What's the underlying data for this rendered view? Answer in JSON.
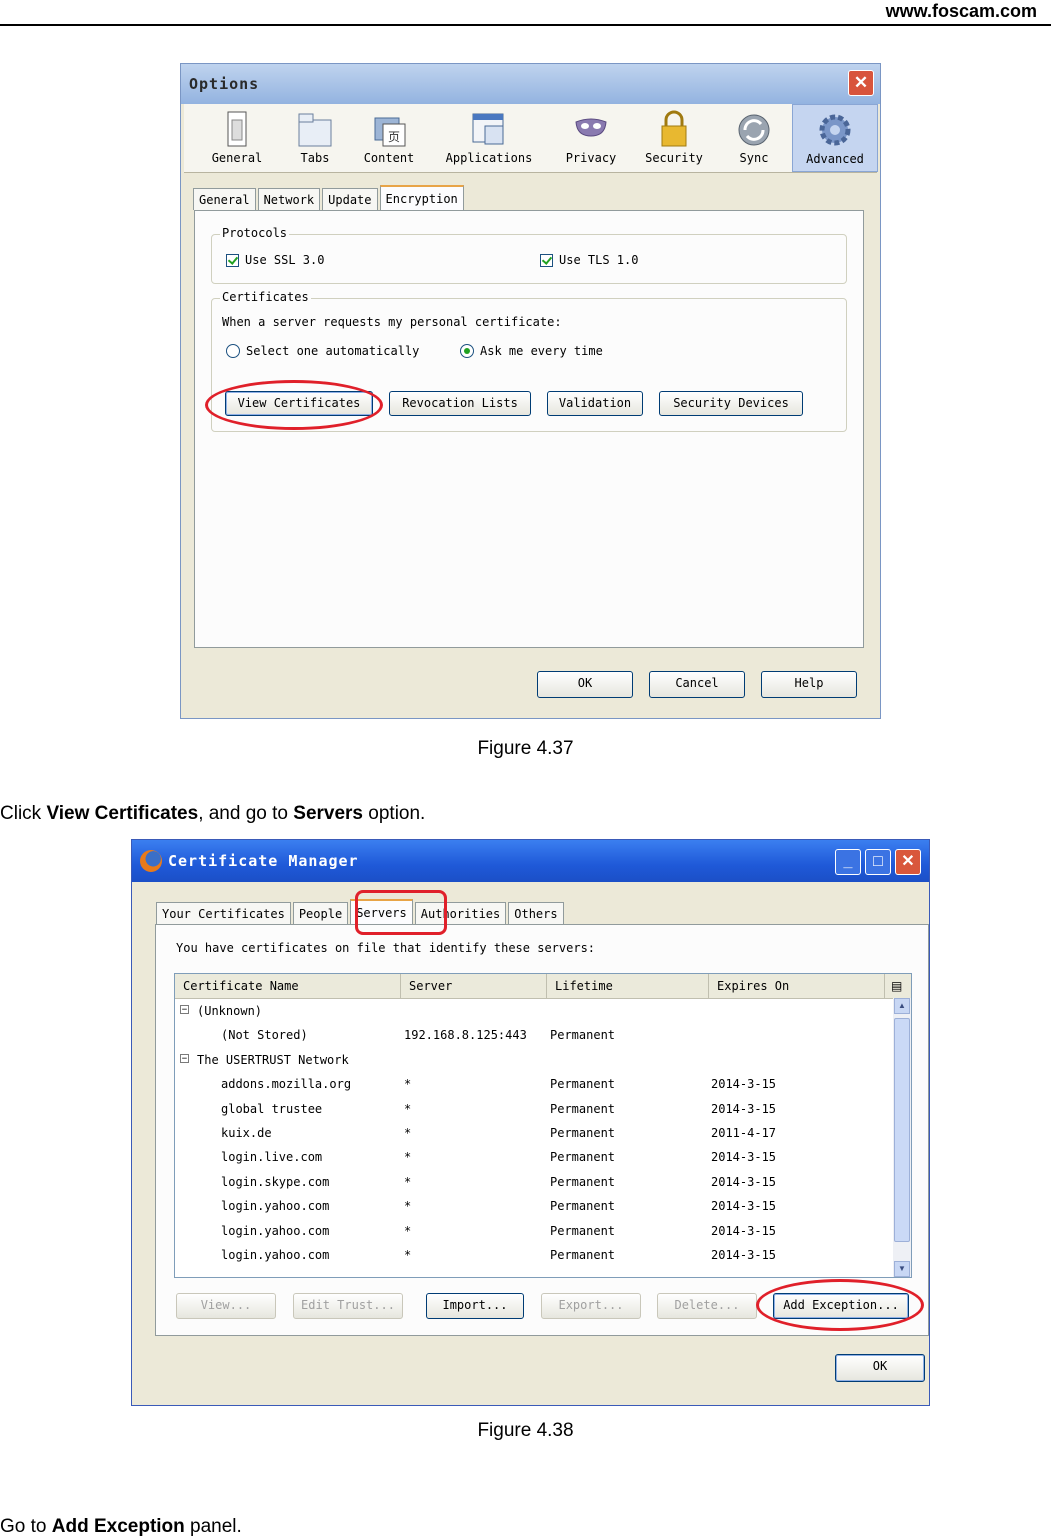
{
  "header": {
    "url": "www.foscam.com"
  },
  "figure1": {
    "caption": "Figure 4.37",
    "window_title": "Options",
    "toolbar": [
      "General",
      "Tabs",
      "Content",
      "Applications",
      "Privacy",
      "Security",
      "Sync",
      "Advanced"
    ],
    "tabs": [
      "General",
      "Network",
      "Update",
      "Encryption"
    ],
    "protocols_legend": "Protocols",
    "ssl_label": "Use SSL 3.0",
    "tls_label": "Use TLS 1.0",
    "certificates_legend": "Certificates",
    "cert_prompt": "When a server requests my personal certificate:",
    "radio_auto": "Select one automatically",
    "radio_ask": "Ask me every time",
    "buttons": [
      "View Certificates",
      "Revocation Lists",
      "Validation",
      "Security Devices"
    ],
    "dialog_buttons": [
      "OK",
      "Cancel",
      "Help"
    ]
  },
  "para1": {
    "prefix": "Click ",
    "bold1": "View Certificates",
    "middle": ", and go to ",
    "bold2": "Servers",
    "suffix": " option."
  },
  "figure2": {
    "caption": "Figure 4.38",
    "window_title": "Certificate Manager",
    "tabs": [
      "Your Certificates",
      "People",
      "Servers",
      "Authorities",
      "Others"
    ],
    "description": "You have certificates on file that identify these servers:",
    "columns": [
      "Certificate Name",
      "Server",
      "Lifetime",
      "Expires On"
    ],
    "groups": [
      {
        "name": "(Unknown)",
        "rows": [
          {
            "name": "(Not Stored)",
            "server": "192.168.8.125:443",
            "lifetime": "Permanent",
            "expires": ""
          }
        ]
      },
      {
        "name": "The USERTRUST Network",
        "rows": [
          {
            "name": "addons.mozilla.org",
            "server": "*",
            "lifetime": "Permanent",
            "expires": "2014-3-15"
          },
          {
            "name": "global trustee",
            "server": "*",
            "lifetime": "Permanent",
            "expires": "2014-3-15"
          },
          {
            "name": "kuix.de",
            "server": "*",
            "lifetime": "Permanent",
            "expires": "2011-4-17"
          },
          {
            "name": "login.live.com",
            "server": "*",
            "lifetime": "Permanent",
            "expires": "2014-3-15"
          },
          {
            "name": "login.skype.com",
            "server": "*",
            "lifetime": "Permanent",
            "expires": "2014-3-15"
          },
          {
            "name": "login.yahoo.com",
            "server": "*",
            "lifetime": "Permanent",
            "expires": "2014-3-15"
          },
          {
            "name": "login.yahoo.com",
            "server": "*",
            "lifetime": "Permanent",
            "expires": "2014-3-15"
          },
          {
            "name": "login.yahoo.com",
            "server": "*",
            "lifetime": "Permanent",
            "expires": "2014-3-15"
          }
        ]
      }
    ],
    "action_buttons": [
      "View...",
      "Edit Trust...",
      "Import...",
      "Export...",
      "Delete...",
      "Add Exception..."
    ],
    "ok_button": "OK"
  },
  "para2": {
    "prefix": "Go to ",
    "bold": "Add Exception",
    "suffix": " panel."
  }
}
